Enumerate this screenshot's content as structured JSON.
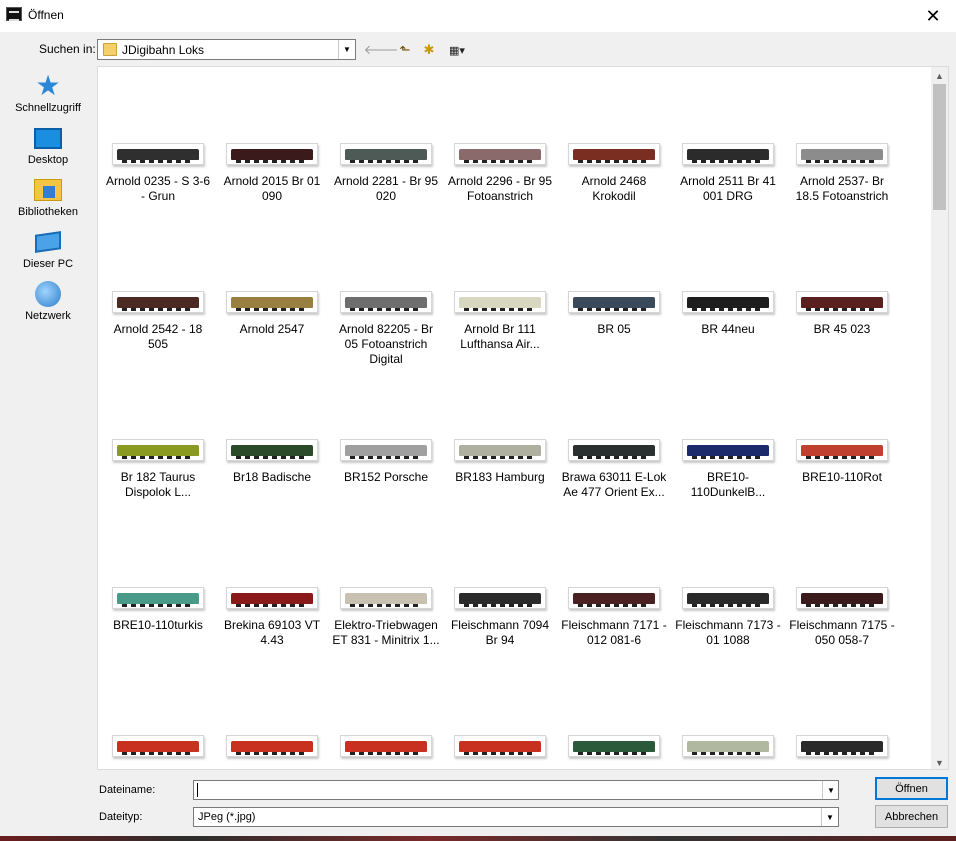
{
  "window": {
    "title": "Öffnen",
    "close_symbol": "✕"
  },
  "toolbar": {
    "look_in_label": "Suchen in:",
    "look_in_value": "JDigibahn Loks",
    "back_icon": "back-arrow-icon",
    "up_icon": "up-folder-icon",
    "newfolder_icon": "new-folder-icon",
    "view_icon": "view-menu-icon"
  },
  "places": [
    {
      "label": "Schnellzugriff",
      "icon": "star-icon"
    },
    {
      "label": "Desktop",
      "icon": "desktop-icon"
    },
    {
      "label": "Bibliotheken",
      "icon": "library-icon"
    },
    {
      "label": "Dieser PC",
      "icon": "computer-icon"
    },
    {
      "label": "Netzwerk",
      "icon": "network-icon"
    }
  ],
  "files": [
    {
      "name": "Arnold 0235 -  S 3-6 - Grun",
      "color": "#2f2f2f"
    },
    {
      "name": "Arnold 2015 Br 01 090",
      "color": "#3a1a1a"
    },
    {
      "name": "Arnold 2281 - Br 95 020",
      "color": "#4d5a55"
    },
    {
      "name": "Arnold 2296 - Br 95 Fotoanstrich",
      "color": "#8a6a6a"
    },
    {
      "name": "Arnold 2468 Krokodil",
      "color": "#7a2e22"
    },
    {
      "name": "Arnold 2511 Br 41 001 DRG",
      "color": "#2b2b2b"
    },
    {
      "name": "Arnold 2537- Br 18.5 Fotoanstrich",
      "color": "#8c8c8c"
    },
    {
      "name": "Arnold 2542 -  18 505",
      "color": "#4a2a22"
    },
    {
      "name": "Arnold 2547",
      "color": "#9a8040"
    },
    {
      "name": "Arnold 82205 - Br 05 Fotoanstrich Digital",
      "color": "#6e6e6e"
    },
    {
      "name": "Arnold Br 111 Lufthansa Air...",
      "color": "#d8d8c0"
    },
    {
      "name": "BR 05",
      "color": "#3a4a5a"
    },
    {
      "name": "BR 44neu",
      "color": "#1e1e1e"
    },
    {
      "name": "BR 45 023",
      "color": "#5a2020"
    },
    {
      "name": "Br 182 Taurus Dispolok L...",
      "color": "#8a9a20"
    },
    {
      "name": "Br18 Badische",
      "color": "#2a4a2a"
    },
    {
      "name": "BR152 Porsche",
      "color": "#a0a0a0"
    },
    {
      "name": "BR183 Hamburg",
      "color": "#b0b0a0"
    },
    {
      "name": "Brawa 63011 E-Lok Ae 477 Orient Ex...",
      "color": "#2a3030"
    },
    {
      "name": "BRE10-110DunkelB...",
      "color": "#1a2a6a"
    },
    {
      "name": "BRE10-110Rot",
      "color": "#c04030"
    },
    {
      "name": "BRE10-110turkis",
      "color": "#4a9a8a"
    },
    {
      "name": "Brekina 69103 VT 4.43",
      "color": "#8a1a1a"
    },
    {
      "name": "Elektro-Triebwagen ET 831 - Minitrix 1...",
      "color": "#c8c0b0"
    },
    {
      "name": "Fleischmann 7094 Br 94",
      "color": "#2a2a2a"
    },
    {
      "name": "Fleischmann 7171 - 012 081-6",
      "color": "#4a2020"
    },
    {
      "name": "Fleischmann 7173 - 01 1088",
      "color": "#2a2a2a"
    },
    {
      "name": "Fleischmann 7175 - 050 058-7",
      "color": "#3a1a1a"
    },
    {
      "name": "",
      "color": "#c83020"
    },
    {
      "name": "",
      "color": "#c83020"
    },
    {
      "name": "",
      "color": "#c83020"
    },
    {
      "name": "",
      "color": "#c83020"
    },
    {
      "name": "",
      "color": "#2a5a3a"
    },
    {
      "name": "",
      "color": "#b0b8a0"
    },
    {
      "name": "",
      "color": "#2a2a2a"
    }
  ],
  "footer": {
    "filename_label": "Dateiname:",
    "filename_value": "",
    "filetype_label": "Dateityp:",
    "filetype_value": "JPeg (*.jpg)",
    "open_label": "Öffnen",
    "cancel_label": "Abbrechen"
  }
}
